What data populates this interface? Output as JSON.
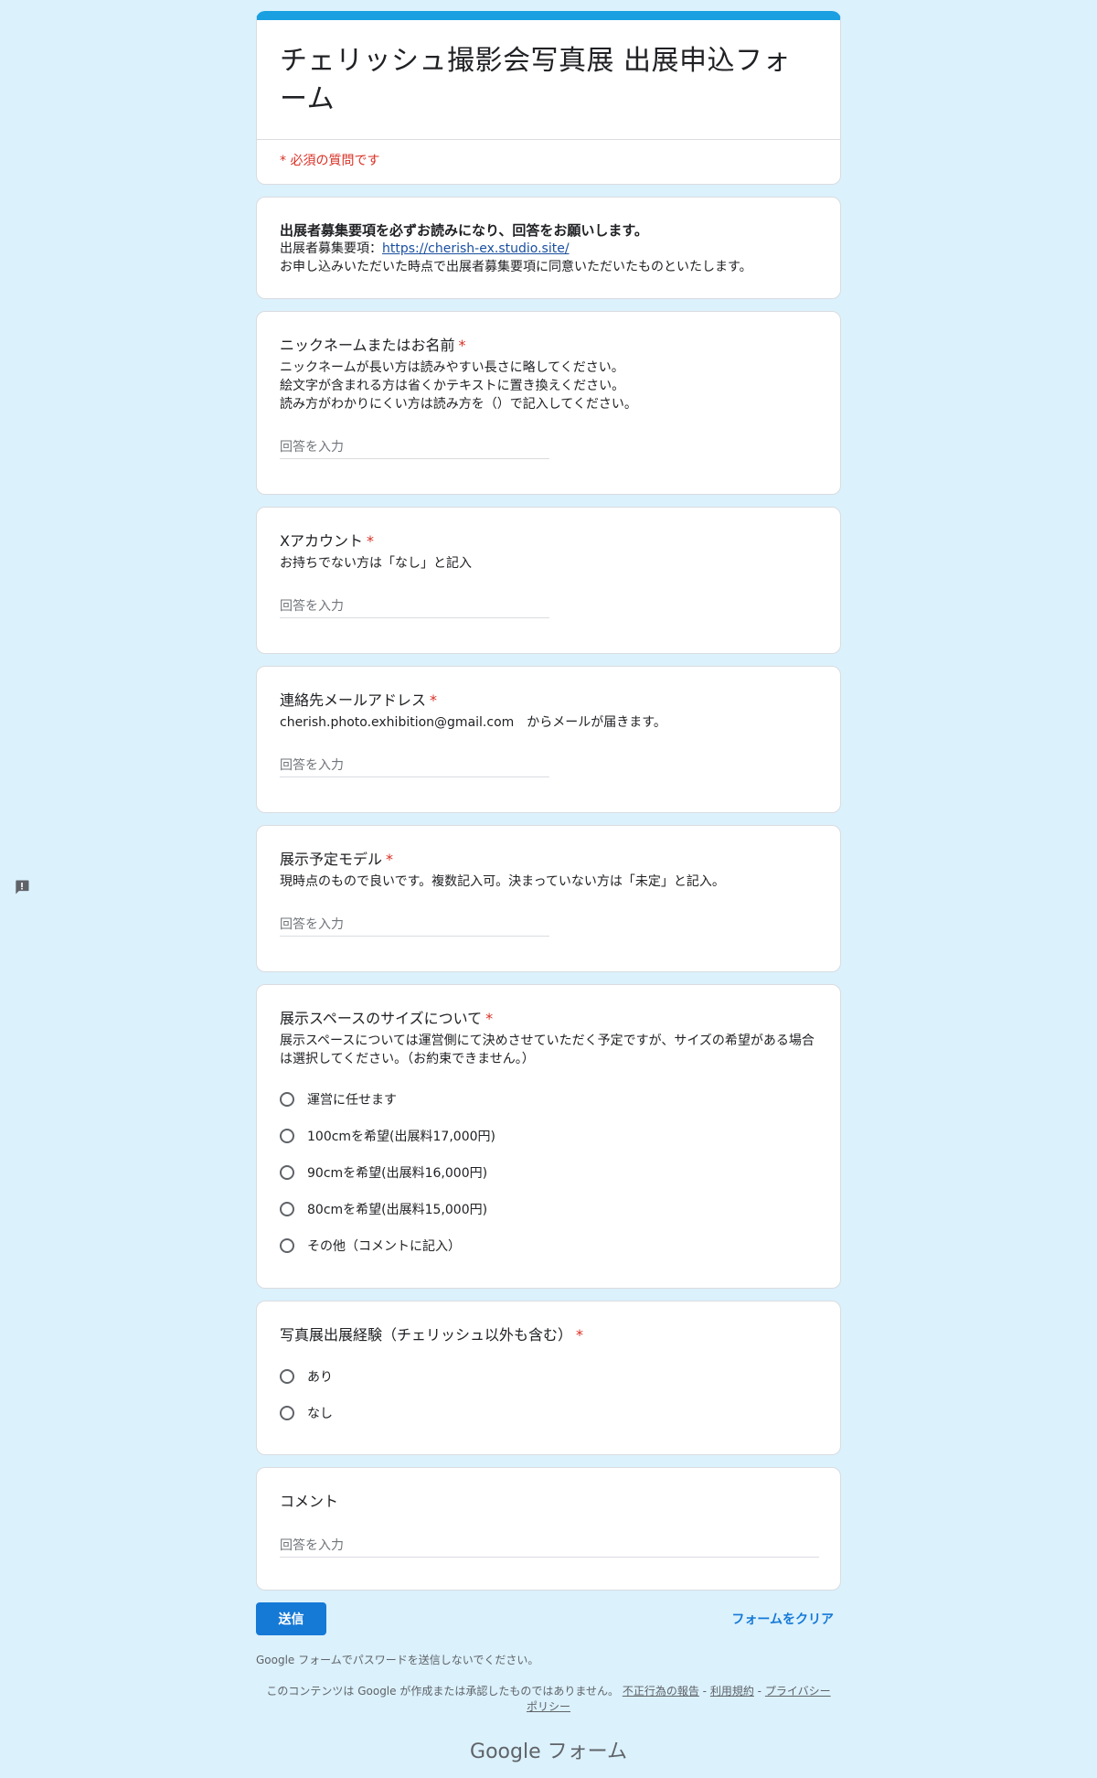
{
  "form": {
    "title": "チェリッシュ撮影会写真展 出展申込フォーム",
    "required_note": "* 必須の質問です"
  },
  "description": {
    "bold": "出展者募集要項を必ずお読みになり、回答をお願いします。",
    "link_prefix": "出展者募集要項：",
    "link_text": "https://cherish-ex.studio.site/",
    "note": "お申し込みいただいた時点で出展者募集要項に同意いただいたものといたします。"
  },
  "questions": {
    "name": {
      "title": "ニックネームまたはお名前",
      "help": [
        "ニックネームが長い方は読みやすい長さに略してください。",
        "絵文字が含まれる方は省くかテキストに置き換えください。",
        "読み方がわかりにくい方は読み方を（）で記入してください。"
      ],
      "placeholder": "回答を入力"
    },
    "x_account": {
      "title": "Xアカウント",
      "help": "お持ちでない方は「なし」と記入",
      "placeholder": "回答を入力"
    },
    "email": {
      "title": "連絡先メールアドレス",
      "help": "cherish.photo.exhibition@gmail.com　からメールが届きます。",
      "placeholder": "回答を入力"
    },
    "model": {
      "title": "展示予定モデル",
      "help": "現時点のもので良いです。複数記入可。決まっていない方は「未定」と記入。",
      "placeholder": "回答を入力"
    },
    "space": {
      "title": "展示スペースのサイズについて",
      "help": "展示スペースについては運営側にて決めさせていただく予定ですが、サイズの希望がある場合は選択してください。（お約束できません。）",
      "options": [
        "運営に任せます",
        "100cmを希望(出展料17,000円)",
        "90cmを希望(出展料16,000円)",
        "80cmを希望(出展料15,000円)",
        "その他（コメントに記入）"
      ]
    },
    "experience": {
      "title": "写真展出展経験（チェリッシュ以外も含む）",
      "options": [
        "あり",
        "なし"
      ]
    },
    "comment": {
      "title": "コメント",
      "placeholder": "回答を入力"
    }
  },
  "required_star": "*",
  "actions": {
    "submit": "送信",
    "clear": "フォームをクリア"
  },
  "footer": {
    "password_note": "Google フォームでパスワードを送信しないでください。",
    "disclaimer": "このコンテンツは Google が作成または承認したものではありません。",
    "report": "不正行為の報告",
    "sep": "-",
    "terms": "利用規約",
    "privacy": "プライバシー ポリシー",
    "brand_google": "Google",
    "brand_forms": "フォーム"
  }
}
